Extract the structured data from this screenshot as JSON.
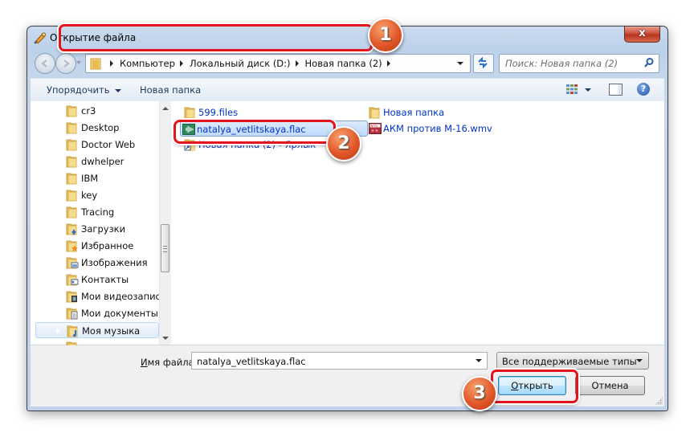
{
  "window": {
    "title": "Открытие файла",
    "close_label": "x"
  },
  "address_bar": {
    "breadcrumbs": [
      "Компьютер",
      "Локальный диск (D:)",
      "Новая папка (2)"
    ],
    "search_placeholder": "Поиск: Новая папка (2)"
  },
  "toolbar": {
    "organize_label": "Упорядочить",
    "new_folder_label": "Новая папка"
  },
  "nav_tree": {
    "items": [
      {
        "label": "cr3",
        "expandable": true,
        "icon": "folder-icon"
      },
      {
        "label": "Desktop",
        "expandable": false,
        "icon": "folder-icon"
      },
      {
        "label": "Doctor Web",
        "expandable": false,
        "icon": "folder-icon"
      },
      {
        "label": "dwhelper",
        "expandable": false,
        "icon": "folder-icon"
      },
      {
        "label": "IBM",
        "expandable": true,
        "icon": "folder-icon"
      },
      {
        "label": "key",
        "expandable": true,
        "icon": "folder-icon"
      },
      {
        "label": "Tracing",
        "expandable": true,
        "icon": "folder-icon"
      },
      {
        "label": "Загрузки",
        "expandable": true,
        "icon": "downloads-folder-icon"
      },
      {
        "label": "Избранное",
        "expandable": true,
        "icon": "favorites-folder-icon"
      },
      {
        "label": "Изображения",
        "expandable": true,
        "icon": "pictures-folder-icon"
      },
      {
        "label": "Контакты",
        "expandable": false,
        "icon": "contacts-folder-icon"
      },
      {
        "label": "Мои видеозаписи",
        "expandable": true,
        "icon": "videos-folder-icon"
      },
      {
        "label": "Мои документы",
        "expandable": true,
        "icon": "documents-folder-icon"
      },
      {
        "label": "Моя музыка",
        "expandable": true,
        "icon": "music-folder-icon",
        "selected": true
      }
    ]
  },
  "files": [
    {
      "label": "599.files",
      "icon": "folder-icon"
    },
    {
      "label": "natalya_vetlitskaya.flac",
      "icon": "audio-file-icon",
      "selected": true
    },
    {
      "label": "Новая папка (2) - Ярлык",
      "icon": "shortcut-icon"
    },
    {
      "label": "Новая папка",
      "icon": "folder-icon"
    },
    {
      "label": "АКМ против М-16.wmv",
      "icon": "video-file-icon"
    }
  ],
  "bottom": {
    "filename_label_accel": "И",
    "filename_label_rest": "мя файла:",
    "filename_value": "natalya_vetlitskaya.flac",
    "filetype_value": "Все поддерживаемые типы",
    "open_accel": "О",
    "open_rest": "ткрыть",
    "cancel_label": "Отмена"
  },
  "annotations": {
    "badge1": "1",
    "badge2": "2",
    "badge3": "3",
    "highlight_color": "#e3141b",
    "badge_color": "#e2572a"
  }
}
